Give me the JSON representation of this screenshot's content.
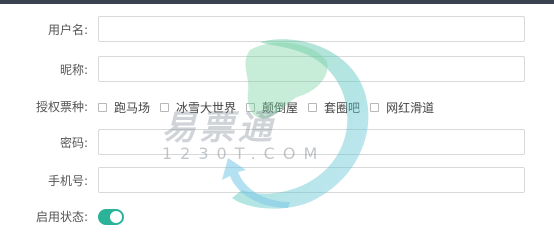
{
  "form": {
    "username": {
      "label": "用户名:",
      "value": "",
      "placeholder": ""
    },
    "nickname": {
      "label": "昵称:",
      "value": "",
      "placeholder": ""
    },
    "tickets": {
      "label": "授权票种:",
      "options": [
        {
          "label": "跑马场",
          "checked": false
        },
        {
          "label": "冰雪大世界",
          "checked": false
        },
        {
          "label": "颠倒屋",
          "checked": false
        },
        {
          "label": "套圈吧",
          "checked": false
        },
        {
          "label": "网红滑道",
          "checked": false
        }
      ]
    },
    "password": {
      "label": "密码:",
      "value": "",
      "placeholder": ""
    },
    "phone": {
      "label": "手机号:",
      "value": "",
      "placeholder": ""
    },
    "status": {
      "label": "启用状态:",
      "enabled": true
    }
  },
  "watermark": {
    "brand": "易票通",
    "domain": "1230T.COM"
  },
  "colors": {
    "toggle_on": "#2bb39a",
    "topbar": "#3a4250"
  }
}
